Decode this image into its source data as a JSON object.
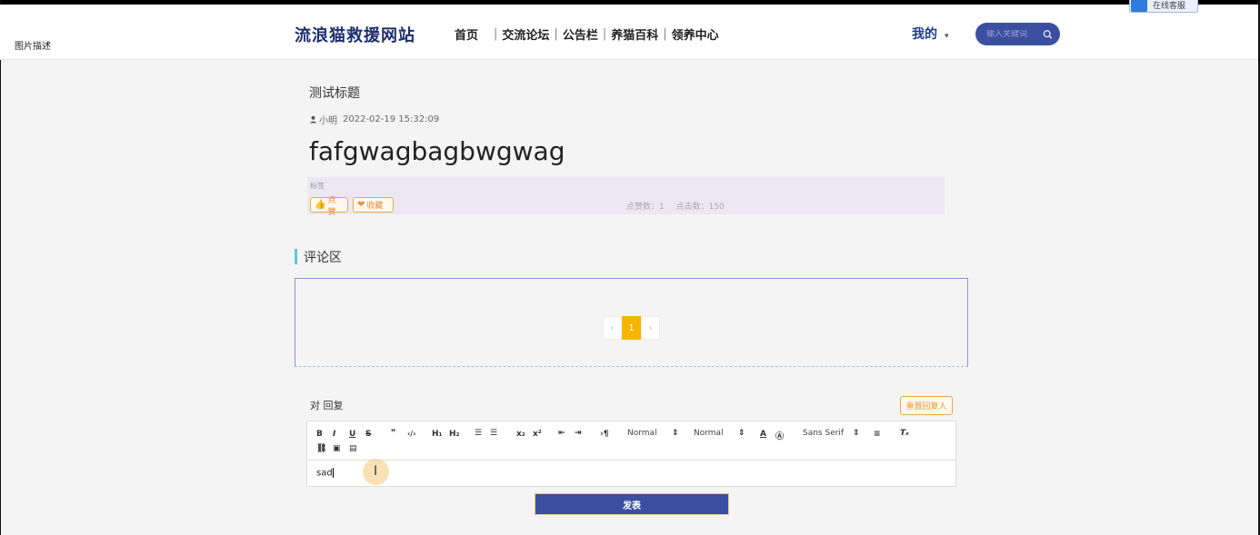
{
  "header": {
    "broken_image_text": "图片描述",
    "logo": "流浪猫救援网站",
    "nav": [
      {
        "label": "首页"
      },
      {
        "label": "交流论坛"
      },
      {
        "label": "公告栏"
      },
      {
        "label": "养猫百科"
      },
      {
        "label": "领养中心"
      }
    ],
    "mine": "我的",
    "search_placeholder": "输入关键词",
    "corner_button": "在线客服"
  },
  "post": {
    "subject": "测试标题",
    "author": "小明",
    "date": "2022-02-19 15:32:09",
    "title": "fafgwagbagbwgwag",
    "tag_label": "标签",
    "like_label": "点赞",
    "favorite_label": "收藏",
    "like_count_text": "点赞数：1",
    "click_count_text": "点击数：150"
  },
  "comments": {
    "section_title": "评论区",
    "pager": {
      "prev": "‹",
      "current": "1",
      "next": "›"
    }
  },
  "reply": {
    "label": "对 回复",
    "reset_button": "重置回复人",
    "toolbar": {
      "header_select": "Normal",
      "size_select": "Normal",
      "font_select": "Sans Serif"
    },
    "content": "sad",
    "submit": "发表"
  },
  "colors": {
    "brand": "#1e2f6e",
    "accent_blue": "#3b4fa0",
    "accent_orange": "#e8a84b",
    "page_active": "#f5b500",
    "section_bar": "#5bc9d8"
  }
}
